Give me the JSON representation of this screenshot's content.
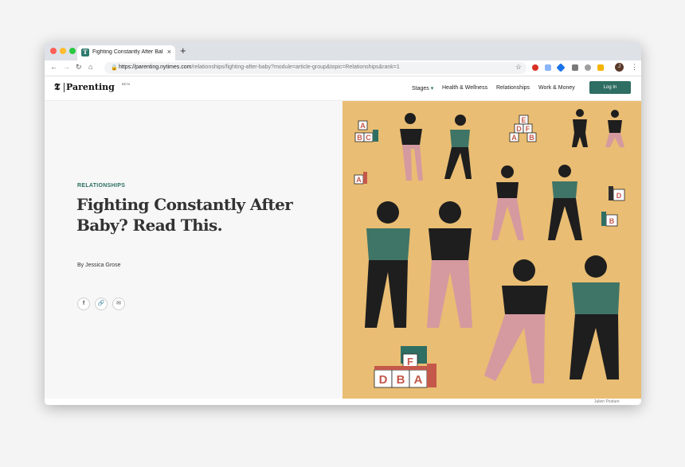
{
  "browser": {
    "tab_title": "Fighting Constantly After Baby",
    "tab_favicon": "T",
    "tab_close": "×",
    "new_tab": "+",
    "url_host": "https://parenting.nytimes.com",
    "url_path": "/relationships/fighting-after-baby?module=article-group&topic=Relationships&rank=1",
    "profile_initial": "J",
    "traffic_lights": [
      "#ff5f57",
      "#febc2e",
      "#28c840"
    ]
  },
  "site": {
    "logo_t": "𝕿",
    "logo_word": "Parenting",
    "logo_beta": "BETA",
    "nav": [
      "Stages",
      "Health & Wellness",
      "Relationships",
      "Work & Money"
    ],
    "stages_caret": "▾",
    "login": "Log In",
    "accent_color": "#2f6e62"
  },
  "article": {
    "kicker": "RELATIONSHIPS",
    "headline": "Fighting Constantly After Baby? Read This.",
    "byline": "By Jessica Grose",
    "share": [
      {
        "icon": "facebook-icon",
        "glyph": "f"
      },
      {
        "icon": "link-icon",
        "glyph": "🔗"
      },
      {
        "icon": "email-icon",
        "glyph": "✉"
      }
    ],
    "illustration_credit": "Julien Posture",
    "illustration_bg": "#e9bd73"
  },
  "illustration": {
    "blocks_tl": [
      "A",
      "B",
      "C"
    ],
    "blocks_tr": [
      "E",
      "D",
      "F",
      "A",
      "B"
    ],
    "block_left": "A",
    "block_right_top": "D",
    "block_right_bottom": "B",
    "blocks_bottom": [
      "F",
      "D",
      "B",
      "A"
    ]
  }
}
